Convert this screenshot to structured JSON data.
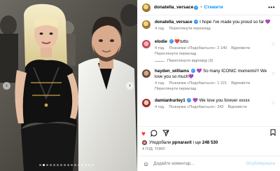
{
  "post": {
    "author": "donatella_versace",
    "follow_label": "Стежити",
    "separator": "•",
    "more_icon": "more-icon",
    "caption": "I hope I've made you proud so far 💜",
    "caption_time": "4 год.",
    "caption_translate": "Переглянути переклад"
  },
  "comments": [
    {
      "user": "elodie",
      "text": "❤️tutto",
      "time": "4 год.",
      "likes": "Позначки «Подобається»: 2 140",
      "reply": "Відповісти",
      "translate": "Переглянути переклад",
      "replies": "Переглянути відповіді (3)"
    },
    {
      "user": "hayden_williams",
      "text": "💜 So many ICONIC moments!!! We love you so much💜",
      "time": "4 год.",
      "likes": "Позначки «Подобається»: 1 221",
      "reply": "Відповісти",
      "translate": "Переглянути переклад"
    },
    {
      "user": "damianhurley1",
      "text": "💜 We love you forever xxxxx",
      "time": "4 год.",
      "likes": "Позначки «Подобається»: 242",
      "reply": "Відповісти"
    }
  ],
  "actions": {
    "like_icon": "heart-icon",
    "comment_icon": "comment-icon",
    "share_icon": "share-icon",
    "save_icon": "bookmark-icon"
  },
  "likes": {
    "prefix": "Уподобали",
    "user": "ppnaravit",
    "suffix": "і ще",
    "count": "248 530"
  },
  "time_ago": "4 ГОД. ТОМУ",
  "add_comment": {
    "placeholder": "Додайте коментар...",
    "publish": "Опублікувати"
  },
  "carousel": {
    "total": 16,
    "active": 1
  }
}
